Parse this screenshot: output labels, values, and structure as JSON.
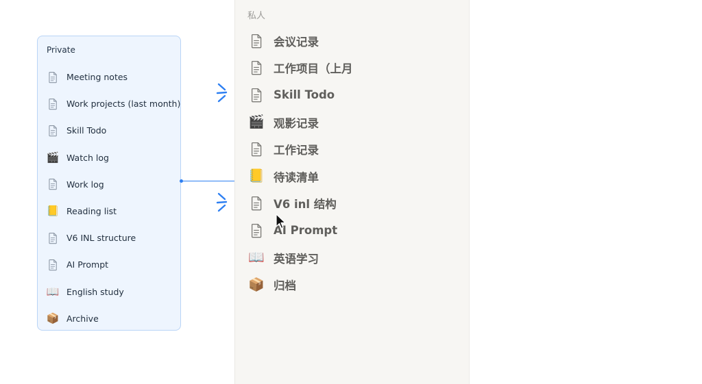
{
  "translation_panel": {
    "title": "Private",
    "items": [
      {
        "label": "Meeting notes",
        "icon": "page-icon"
      },
      {
        "label": "Work projects (last month)",
        "icon": "page-icon"
      },
      {
        "label": "Skill Todo",
        "icon": "page-icon"
      },
      {
        "label": "Watch log",
        "icon": "clapperboard-icon",
        "glyph": "🎬"
      },
      {
        "label": "Work log",
        "icon": "page-icon"
      },
      {
        "label": "Reading list",
        "icon": "yellow-book-icon",
        "glyph": "📒"
      },
      {
        "label": "V6 INL structure",
        "icon": "page-icon"
      },
      {
        "label": "AI Prompt",
        "icon": "page-icon"
      },
      {
        "label": "English study",
        "icon": "open-book-icon",
        "glyph": "📖"
      },
      {
        "label": "Archive",
        "icon": "package-icon",
        "glyph": "📦"
      }
    ]
  },
  "sidebar": {
    "section_label": "私人",
    "items": [
      {
        "label": "会议记录",
        "icon": "page-icon"
      },
      {
        "label": "工作项目（上月",
        "icon": "page-icon"
      },
      {
        "label": "Skill Todo",
        "icon": "page-icon"
      },
      {
        "label": "观影记录",
        "icon": "clapperboard-icon",
        "glyph": "🎬"
      },
      {
        "label": "工作记录",
        "icon": "page-icon"
      },
      {
        "label": "待读清单",
        "icon": "yellow-book-icon",
        "glyph": "📒"
      },
      {
        "label": "V6 inl 结构",
        "icon": "page-icon"
      },
      {
        "label": "AI Prompt",
        "icon": "page-icon"
      },
      {
        "label": "英语学习",
        "icon": "open-book-icon",
        "glyph": "📖"
      },
      {
        "label": "归档",
        "icon": "package-icon",
        "glyph": "📦"
      }
    ]
  },
  "colors": {
    "accent": "#2d7ff2",
    "panel_bg": "#eef5fe",
    "sidebar_bg": "#f7f6f3"
  }
}
